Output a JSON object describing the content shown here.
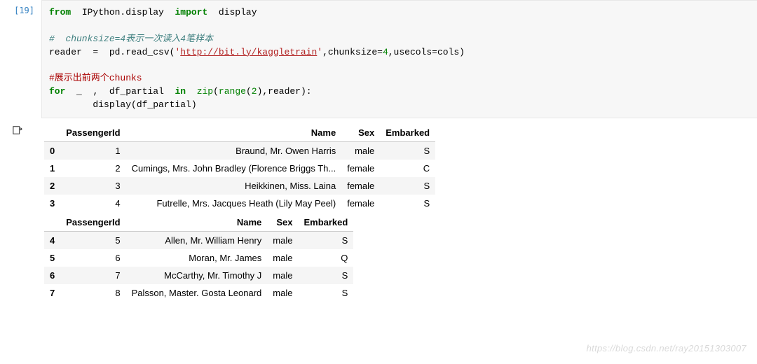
{
  "input_prompt": "[19]",
  "code": {
    "line1": {
      "from": "from",
      "mod": "IPython.display",
      "imp": "import",
      "name": "display"
    },
    "comment1": "#  chunksize=4表示一次读入4笔样本",
    "line3_a": "reader  =  pd.read_csv(",
    "line3_url": "http://bit.ly/kaggletrain",
    "line3_b": ",chunksize=",
    "line3_n": "4",
    "line3_c": ",usecols=cols)",
    "comment2": "#展示出前两个chunks",
    "line5": {
      "for": "for",
      "under": "_",
      "comma": " , ",
      "var": "df_partial",
      "in": "in",
      "zip": "zip",
      "rng": "range",
      "two": "2",
      "rest": ",reader):"
    },
    "line6": "        display(df_partial)"
  },
  "table1": {
    "headers": [
      "",
      "PassengerId",
      "Name",
      "Sex",
      "Embarked"
    ],
    "rows": [
      [
        "0",
        "1",
        "Braund, Mr. Owen Harris",
        "male",
        "S"
      ],
      [
        "1",
        "2",
        "Cumings, Mrs. John Bradley (Florence Briggs Th...",
        "female",
        "C"
      ],
      [
        "2",
        "3",
        "Heikkinen, Miss. Laina",
        "female",
        "S"
      ],
      [
        "3",
        "4",
        "Futrelle, Mrs. Jacques Heath (Lily May Peel)",
        "female",
        "S"
      ]
    ]
  },
  "table2": {
    "headers": [
      "",
      "PassengerId",
      "Name",
      "Sex",
      "Embarked"
    ],
    "rows": [
      [
        "4",
        "5",
        "Allen, Mr. William Henry",
        "male",
        "S"
      ],
      [
        "5",
        "6",
        "Moran, Mr. James",
        "male",
        "Q"
      ],
      [
        "6",
        "7",
        "McCarthy, Mr. Timothy J",
        "male",
        "S"
      ],
      [
        "7",
        "8",
        "Palsson, Master. Gosta Leonard",
        "male",
        "S"
      ]
    ]
  },
  "watermark": "https://blog.csdn.net/ray20151303007"
}
